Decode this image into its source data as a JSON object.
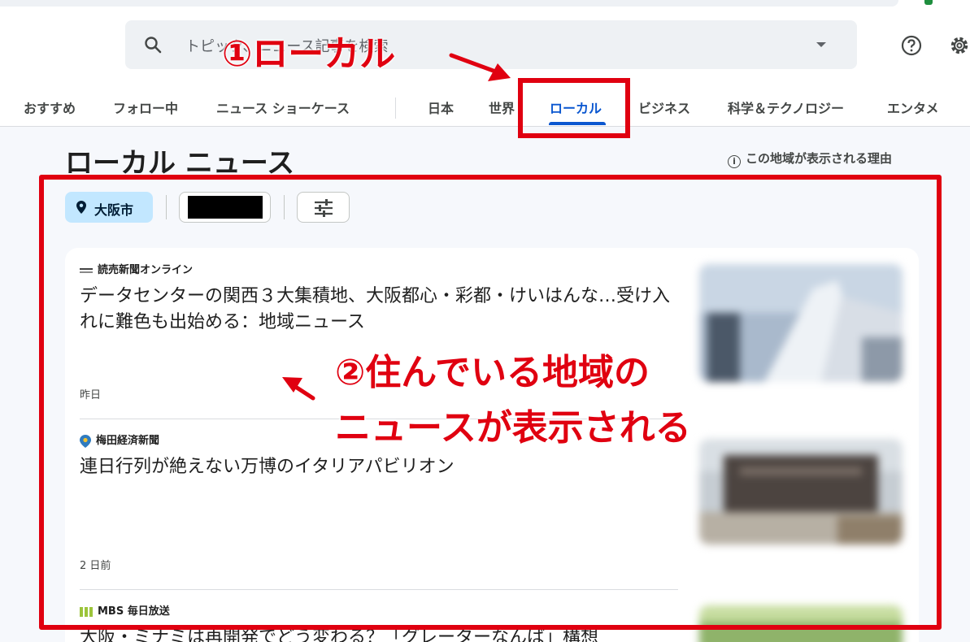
{
  "search": {
    "placeholder": "トピック、ニュース記事を検索"
  },
  "tabs": [
    {
      "label": "おすすめ"
    },
    {
      "label": "フォロー中"
    },
    {
      "label": "ニュース ショーケース"
    },
    {
      "label": "日本"
    },
    {
      "label": "世界"
    },
    {
      "label": "ローカル"
    },
    {
      "label": "ビジネス"
    },
    {
      "label": "科学＆テクノロジー"
    },
    {
      "label": "エンタメ"
    }
  ],
  "page": {
    "title": "ローカル ニュース",
    "reason_link": "この地域が表示される理由"
  },
  "chips": {
    "location": "大阪市"
  },
  "articles": [
    {
      "source": "読売新聞オンライン",
      "headline": "データセンターの関西３大集積地、大阪都心・彩都・けいはんな…受け入れに難色も出始める：地域ニュース",
      "time": "昨日"
    },
    {
      "source": "梅田経済新聞",
      "headline": "連日行列が絶えない万博のイタリアパビリオン",
      "time": "2 日前"
    },
    {
      "source": "MBS 毎日放送",
      "headline": "大阪・ミナミは再開発でどう変わる？「グレーターなんば」構想",
      "time": ""
    }
  ],
  "annotations": {
    "step1": "①ローカル",
    "step2_line1": "②住んでいる地域の",
    "step2_line2": "ニュースが表示される",
    "color": "#e00010"
  },
  "colors": {
    "accent": "#0b57d0",
    "chip_bg": "#c2e7ff"
  }
}
